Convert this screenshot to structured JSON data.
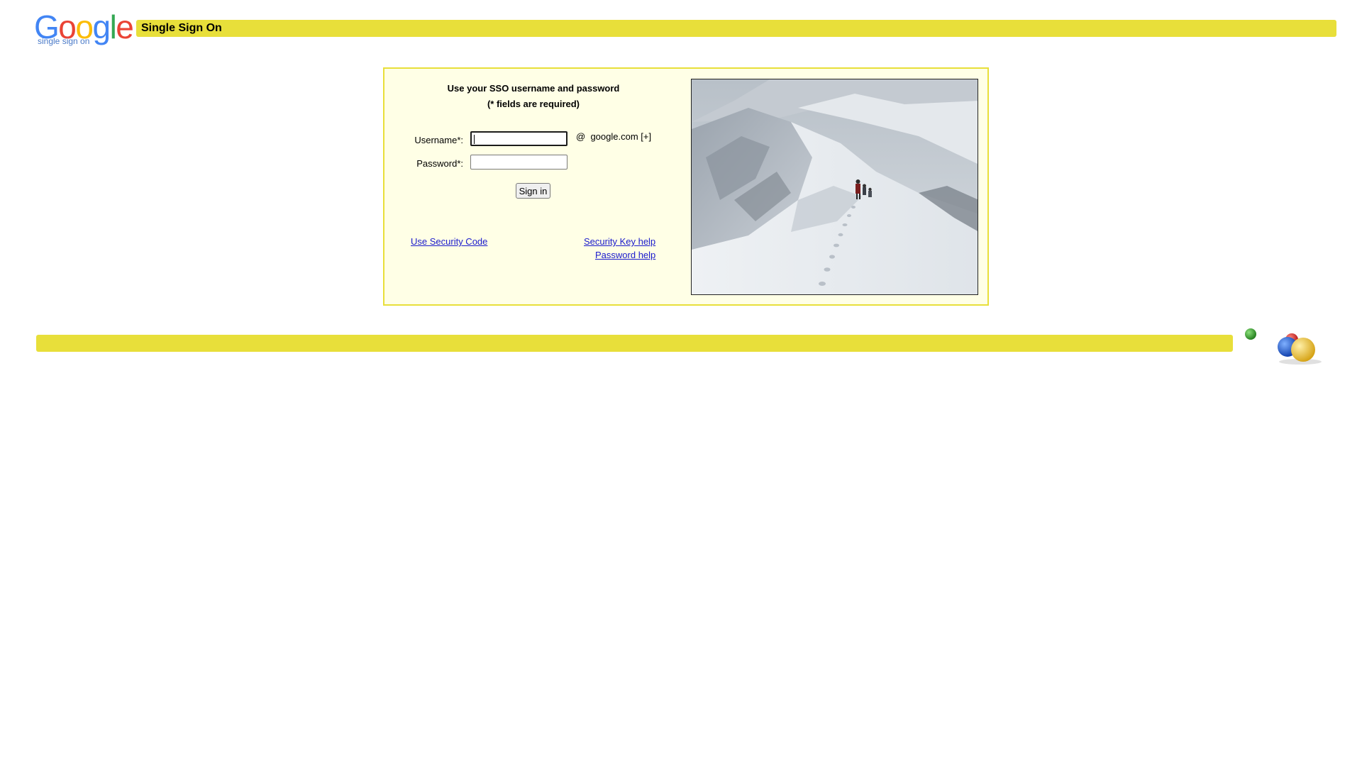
{
  "header": {
    "logo_text": "Google",
    "logo_subtext": "single sign on",
    "title": "Single Sign On"
  },
  "login": {
    "instruction_line1": "Use your SSO username and password",
    "instruction_line2": "(* fields are required)",
    "username_label": "Username*:",
    "username_value": "",
    "password_label": "Password*:",
    "password_value": "",
    "at_symbol": "@",
    "domain_text": "google.com [+]",
    "signin_label": "Sign in"
  },
  "links": {
    "security_code": "Use Security Code",
    "security_key_help": "Security Key help",
    "password_help": "Password help"
  },
  "photo": {
    "subject": "snowy-mountain-ridge-hikers"
  },
  "colors": {
    "accent_yellow": "#e8df3a",
    "panel_bg": "#ffffe6",
    "link_blue": "#1a1acc",
    "logo_blue": "#4285f4",
    "logo_red": "#ea4335",
    "logo_yellow": "#fbbc05",
    "logo_green": "#34a853"
  }
}
